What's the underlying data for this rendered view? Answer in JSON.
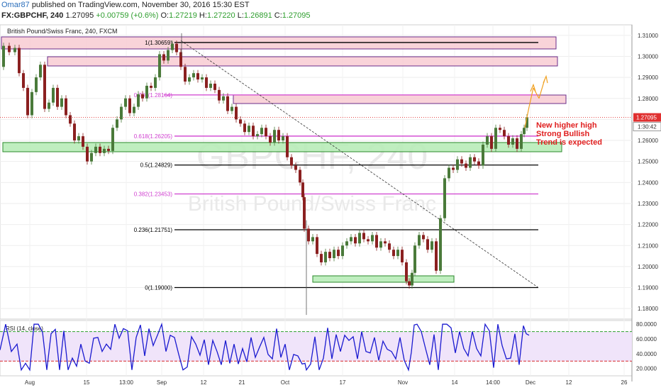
{
  "header": {
    "author": "Omar87",
    "published": "published on TradingView.com, November 30, 2016 15:30 EST",
    "symbol": "FX:GBPCHF, 240",
    "last": "1.27095",
    "change": "+0.00759 (+0.6%)",
    "open_label": "O:",
    "open": "1.27219",
    "high_label": "H:",
    "high": "1.27220",
    "low_label": "L:",
    "low": "1.26891",
    "close_label": "C:",
    "close": "1.27095"
  },
  "chart_data": [
    {
      "type": "line",
      "title": "British Pound/Swiss Franc, 240, FXCM",
      "watermark_symbol": "GBPCHF, 240",
      "watermark_name": "British Pound/Swiss Franc",
      "y_ticks": [
        "1.31000",
        "1.30000",
        "1.29000",
        "1.28000",
        "1.27000",
        "1.26000",
        "1.25000",
        "1.24000",
        "1.23000",
        "1.22000",
        "1.21000",
        "1.20000",
        "1.19000",
        "1.18000"
      ],
      "ylim": [
        1.175,
        1.315
      ],
      "x_ticks": [
        "Aug",
        "15",
        "13:00",
        "Sep",
        "12",
        "21",
        "Oct",
        "17",
        "Nov",
        "14",
        "14:00",
        "Dec",
        "12",
        "26"
      ],
      "last_price_label": "1.27095",
      "timer_label": "1:30:42",
      "fib_levels": [
        {
          "label": "1(1.30659)",
          "value": 1.30659,
          "color": "#000000"
        },
        {
          "label": "0.786(1.28164)",
          "value": 1.28164,
          "color": "#d040d0"
        },
        {
          "label": "0.618(1.26205)",
          "value": 1.26205,
          "color": "#d040d0"
        },
        {
          "label": "0.5(1.24829)",
          "value": 1.24829,
          "color": "#000000"
        },
        {
          "label": "0.382(1.23453)",
          "value": 1.23453,
          "color": "#d040d0"
        },
        {
          "label": "0.236(1.21751)",
          "value": 1.21751,
          "color": "#000000"
        },
        {
          "label": "0(1.19000)",
          "value": 1.19,
          "color": "#000000"
        }
      ],
      "price_path": [
        [
          0,
          1.295
        ],
        [
          8,
          1.305
        ],
        [
          16,
          1.302
        ],
        [
          24,
          1.304
        ],
        [
          30,
          1.292
        ],
        [
          36,
          1.285
        ],
        [
          42,
          1.272
        ],
        [
          48,
          1.283
        ],
        [
          54,
          1.29
        ],
        [
          60,
          1.296
        ],
        [
          66,
          1.275
        ],
        [
          72,
          1.278
        ],
        [
          78,
          1.285
        ],
        [
          84,
          1.276
        ],
        [
          90,
          1.28
        ],
        [
          96,
          1.272
        ],
        [
          102,
          1.268
        ],
        [
          108,
          1.26
        ],
        [
          114,
          1.262
        ],
        [
          120,
          1.257
        ],
        [
          126,
          1.25
        ],
        [
          132,
          1.254
        ],
        [
          138,
          1.257
        ],
        [
          144,
          1.254
        ],
        [
          150,
          1.256
        ],
        [
          156,
          1.255
        ],
        [
          162,
          1.266
        ],
        [
          168,
          1.27
        ],
        [
          174,
          1.276
        ],
        [
          180,
          1.28
        ],
        [
          186,
          1.273
        ],
        [
          192,
          1.276
        ],
        [
          198,
          1.282
        ],
        [
          204,
          1.28
        ],
        [
          210,
          1.286
        ],
        [
          216,
          1.285
        ],
        [
          222,
          1.29
        ],
        [
          228,
          1.301
        ],
        [
          234,
          1.298
        ],
        [
          240,
          1.303
        ],
        [
          246,
          1.306
        ],
        [
          252,
          1.302
        ],
        [
          258,
          1.295
        ],
        [
          264,
          1.288
        ],
        [
          270,
          1.29
        ],
        [
          276,
          1.292
        ],
        [
          282,
          1.289
        ],
        [
          288,
          1.29
        ],
        [
          294,
          1.285
        ],
        [
          300,
          1.287
        ],
        [
          306,
          1.284
        ],
        [
          312,
          1.279
        ],
        [
          318,
          1.281
        ],
        [
          324,
          1.274
        ],
        [
          330,
          1.276
        ],
        [
          336,
          1.27
        ],
        [
          342,
          1.268
        ],
        [
          348,
          1.264
        ],
        [
          354,
          1.267
        ],
        [
          360,
          1.262
        ],
        [
          366,
          1.263
        ],
        [
          372,
          1.266
        ],
        [
          378,
          1.262
        ],
        [
          384,
          1.259
        ],
        [
          390,
          1.265
        ],
        [
          396,
          1.26
        ],
        [
          402,
          1.262
        ],
        [
          408,
          1.252
        ],
        [
          414,
          1.248
        ],
        [
          420,
          1.246
        ],
        [
          426,
          1.24
        ],
        [
          430,
          1.233
        ],
        [
          432,
          1.218
        ],
        [
          438,
          1.212
        ],
        [
          444,
          1.214
        ],
        [
          450,
          1.206
        ],
        [
          456,
          1.202
        ],
        [
          462,
          1.207
        ],
        [
          468,
          1.204
        ],
        [
          474,
          1.208
        ],
        [
          480,
          1.205
        ],
        [
          486,
          1.21
        ],
        [
          492,
          1.212
        ],
        [
          498,
          1.214
        ],
        [
          504,
          1.211
        ],
        [
          510,
          1.216
        ],
        [
          516,
          1.213
        ],
        [
          522,
          1.212
        ],
        [
          528,
          1.215
        ],
        [
          534,
          1.209
        ],
        [
          540,
          1.212
        ],
        [
          546,
          1.211
        ],
        [
          552,
          1.208
        ],
        [
          558,
          1.205
        ],
        [
          564,
          1.208
        ],
        [
          570,
          1.202
        ],
        [
          576,
          1.193
        ],
        [
          580,
          1.191
        ],
        [
          584,
          1.197
        ],
        [
          588,
          1.21
        ],
        [
          594,
          1.215
        ],
        [
          600,
          1.213
        ],
        [
          606,
          1.208
        ],
        [
          612,
          1.212
        ],
        [
          618,
          1.198
        ],
        [
          624,
          1.223
        ],
        [
          630,
          1.242
        ],
        [
          636,
          1.247
        ],
        [
          642,
          1.246
        ],
        [
          648,
          1.251
        ],
        [
          654,
          1.249
        ],
        [
          660,
          1.247
        ],
        [
          666,
          1.252
        ],
        [
          672,
          1.25
        ],
        [
          678,
          1.248
        ],
        [
          684,
          1.258
        ],
        [
          690,
          1.262
        ],
        [
          696,
          1.256
        ],
        [
          702,
          1.266
        ],
        [
          708,
          1.265
        ],
        [
          714,
          1.262
        ],
        [
          720,
          1.258
        ],
        [
          726,
          1.261
        ],
        [
          732,
          1.256
        ],
        [
          738,
          1.263
        ],
        [
          742,
          1.266
        ],
        [
          746,
          1.271
        ]
      ],
      "rsi": {
        "label": "RSI (14, close)",
        "y_ticks": [
          "80.0000",
          "60.0000",
          "40.0000",
          "20.0000"
        ],
        "ylim": [
          10,
          85
        ],
        "upper_band": 70,
        "lower_band": 30
      },
      "annotations": [
        "New higher high",
        "Strong Bullish",
        "Trend is expected"
      ]
    }
  ],
  "colors": {
    "candle_up": "#4a7a3a",
    "candle_down": "#8b2020",
    "zone_resistance": "#f8c8d0",
    "zone_support": "#b8ecb8",
    "rsi_line": "#1a1ad0",
    "rsi_band_fill": "#f0e4fa",
    "arrow": "#f0a020",
    "annotation_text": "#e02020",
    "last_price": "#e03030"
  }
}
